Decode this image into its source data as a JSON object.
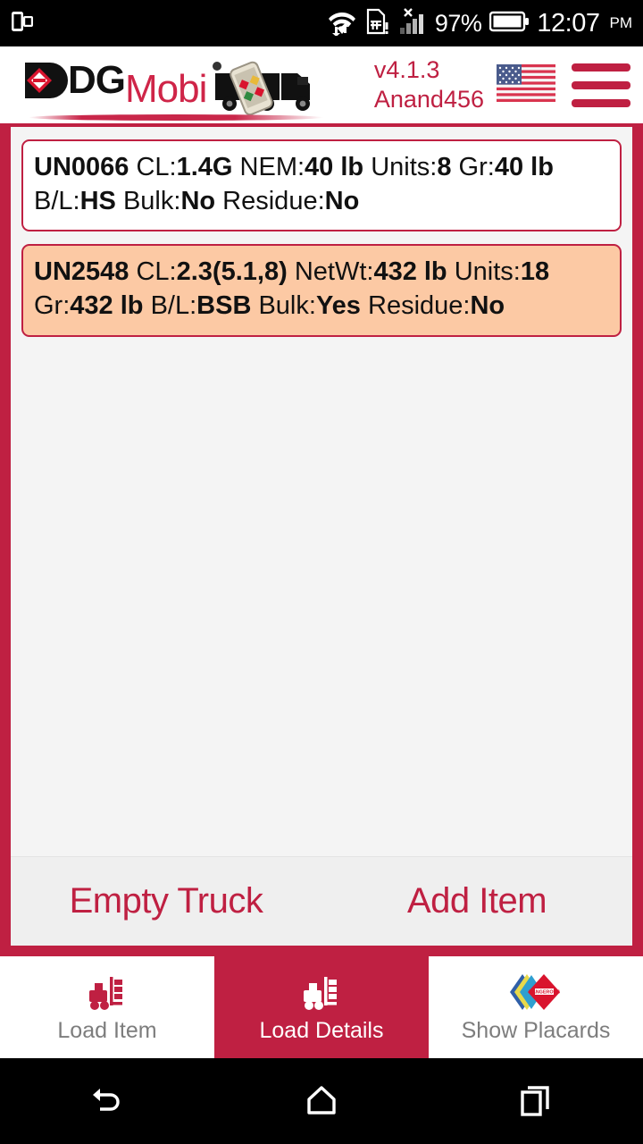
{
  "status_bar": {
    "battery_percent": "97%",
    "time": "12:07",
    "meridiem": "PM",
    "icons": [
      "phone-link-icon",
      "wifi-icon",
      "sim-card-alert-icon",
      "signal-no-service-icon",
      "battery-icon"
    ]
  },
  "header": {
    "logo_dg": "DG",
    "logo_mobi": "Mobi",
    "version": "v4.1.3",
    "username": "Anand456",
    "flag": "us-flag-icon",
    "menu": "hamburger-menu-icon"
  },
  "items": [
    {
      "un": "UN0066",
      "cl_label": "CL:",
      "cl": "1.4G",
      "wt_label": "NEM:",
      "wt": "40 lb",
      "units_label": "Units:",
      "units": "8",
      "gr_label": "Gr:",
      "gr": "40 lb",
      "bl_label": "B/L:",
      "bl": "HS",
      "bulk_label": "Bulk:",
      "bulk": "No",
      "residue_label": "Residue:",
      "residue": "No",
      "selected": false
    },
    {
      "un": "UN2548",
      "cl_label": "CL:",
      "cl": "2.3(5.1,8)",
      "wt_label": "NetWt:",
      "wt": "432 lb",
      "units_label": "Units:",
      "units": "18",
      "gr_label": "Gr:",
      "gr": "432 lb",
      "bl_label": "B/L:",
      "bl": "BSB",
      "bulk_label": "Bulk:",
      "bulk": "Yes",
      "residue_label": "Residue:",
      "residue": "No",
      "selected": true
    }
  ],
  "actions": {
    "empty_truck": "Empty Truck",
    "add_item": "Add Item"
  },
  "tabs": [
    {
      "label": "Load Item",
      "icon": "forklift-icon",
      "active": false
    },
    {
      "label": "Load Details",
      "icon": "forklift-icon",
      "active": true
    },
    {
      "label": "Show Placards",
      "icon": "placard-diamond-icon",
      "active": false
    }
  ],
  "nav_bar": {
    "back": "back-icon",
    "home": "home-icon",
    "recents": "recents-icon"
  },
  "colors": {
    "accent": "#bf2042",
    "selected_row": "#fcc9a4",
    "panel": "#f4f4f4",
    "inactive_tab_text": "#7d7d7d"
  }
}
